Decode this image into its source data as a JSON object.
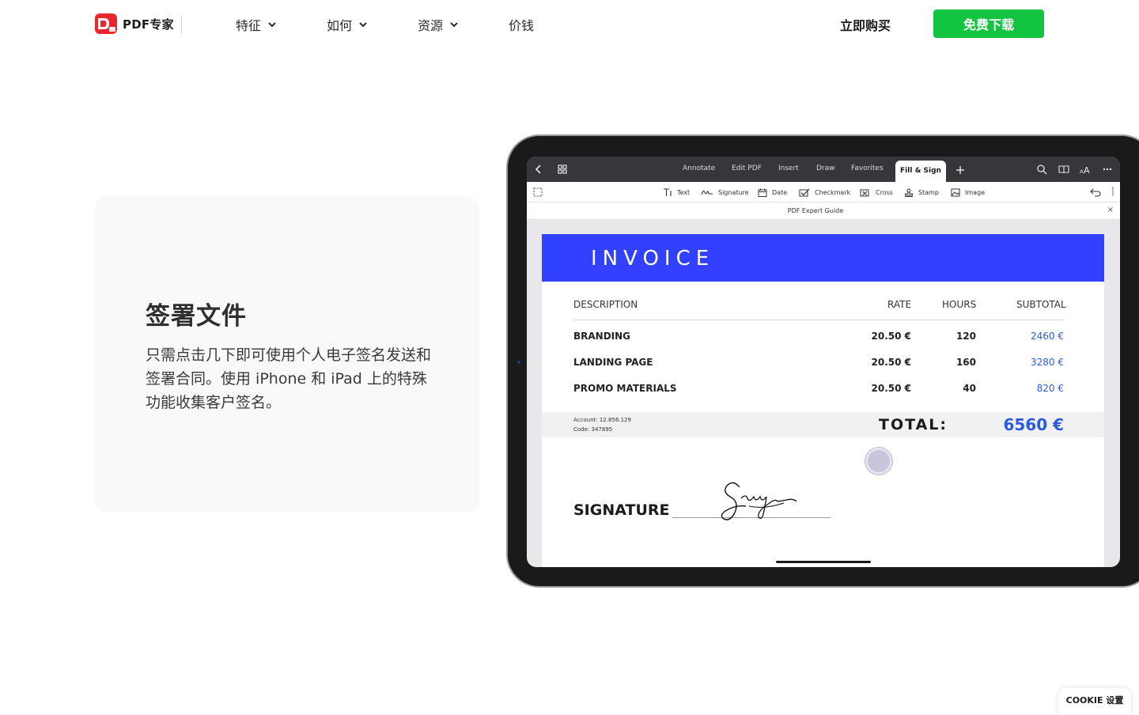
{
  "header": {
    "logo_text": "PDF专家",
    "nav": [
      {
        "label": "特征",
        "has_dropdown": true
      },
      {
        "label": "如何",
        "has_dropdown": true
      },
      {
        "label": "资源",
        "has_dropdown": true
      },
      {
        "label": "价钱",
        "has_dropdown": false
      }
    ],
    "buy_label": "立即购买",
    "download_label": "免费下载"
  },
  "feature": {
    "title": "签署文件",
    "description": "只需点击几下即可使用个人电子签名发送和签署合同。使用 iPhone 和 iPad 上的特殊功能收集客户签名。"
  },
  "ipad": {
    "tabs": [
      "Annotate",
      "Edit PDF",
      "Insert",
      "Draw",
      "Favorites",
      "Fill & Sign"
    ],
    "active_tab": "Fill & Sign",
    "tools": [
      "Text",
      "Signature",
      "Date",
      "Checkmark",
      "Cross",
      "Stamp",
      "Image"
    ],
    "doc_title": "PDF Expert Guide",
    "invoice": {
      "title": "INVOICE",
      "columns": [
        "DESCRIPTION",
        "RATE",
        "HOURS",
        "SUBTOTAL"
      ],
      "rows": [
        {
          "description": "BRANDING",
          "rate": "20.50 €",
          "hours": "120",
          "subtotal": "2460 €"
        },
        {
          "description": "LANDING PAGE",
          "rate": "20.50 €",
          "hours": "160",
          "subtotal": "3280 €"
        },
        {
          "description": "PROMO MATERIALS",
          "rate": "20.50 €",
          "hours": "40",
          "subtotal": "820 €"
        }
      ],
      "account": "Account: 12.856.129",
      "code": "Code: 347895",
      "total_label": "TOTAL:",
      "total_value": "6560 €",
      "signature_label": "SIGNATURE"
    }
  },
  "cookie_label": "COOKIE 设置",
  "colors": {
    "brand_red": "#e8262d",
    "download_green": "#12c43f",
    "invoice_blue": "#3241ff",
    "amount_blue": "#2a5bdf"
  }
}
